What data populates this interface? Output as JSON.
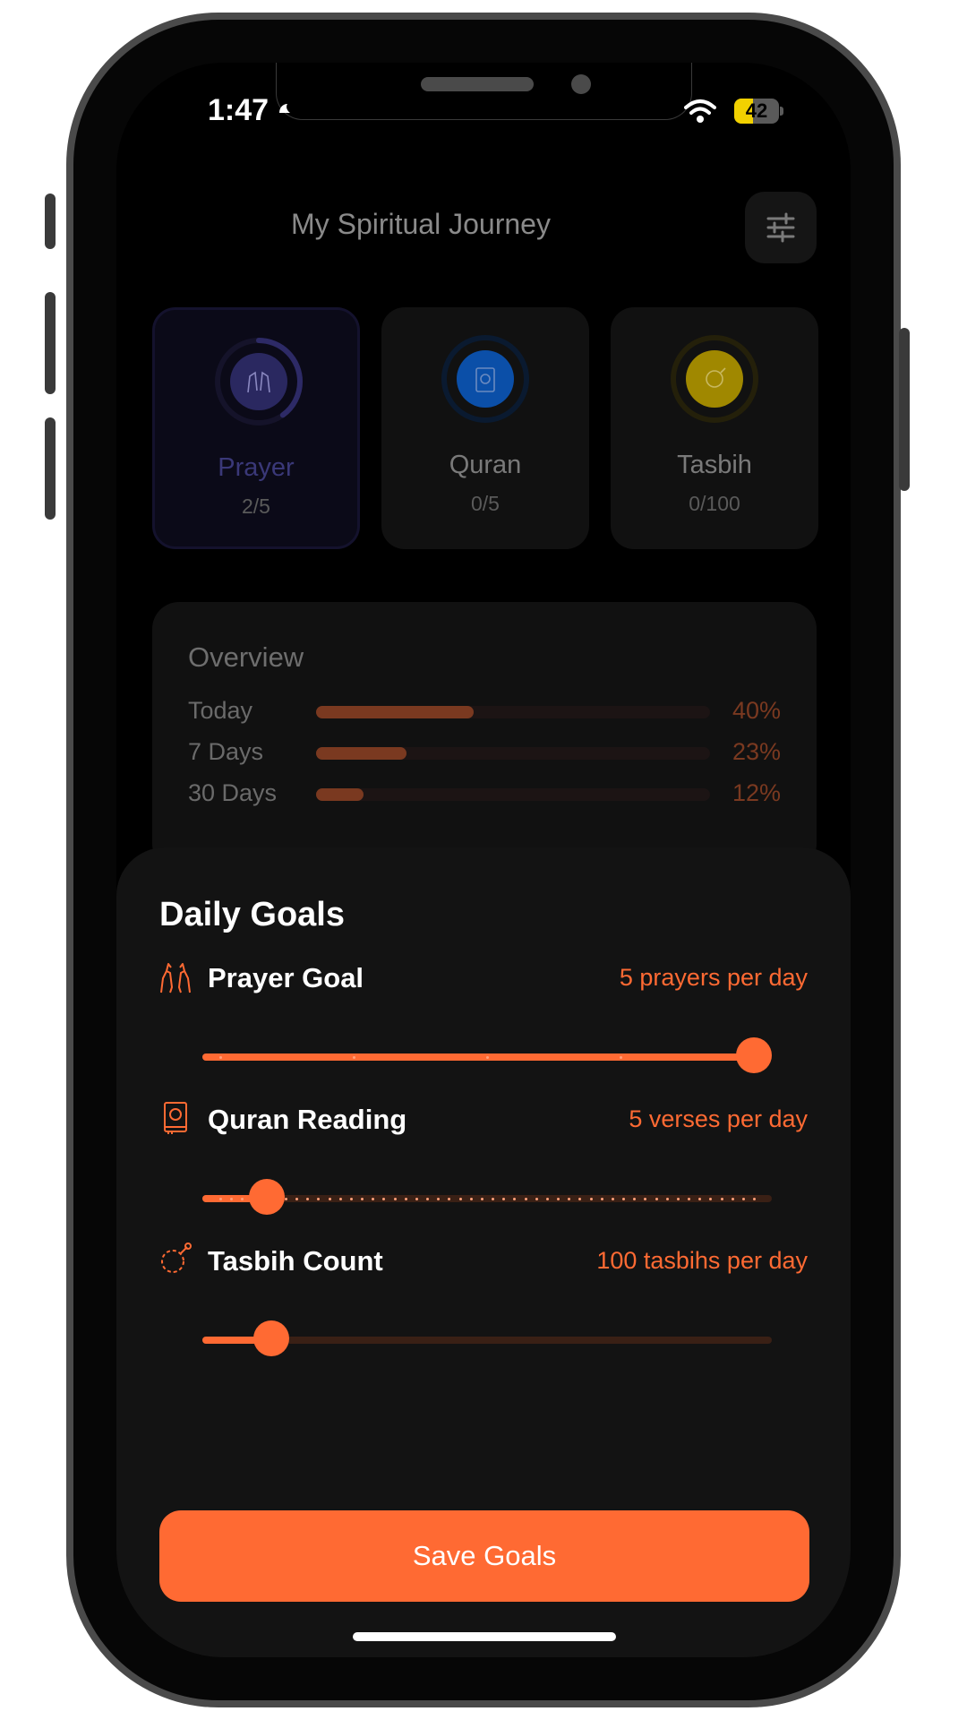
{
  "status_bar": {
    "time": "1:47",
    "battery": "42",
    "battery_level": 0.42
  },
  "header": {
    "title": "My Spiritual Journey",
    "settings_icon": "sliders-icon"
  },
  "cards": [
    {
      "title": "Prayer",
      "count": "2/5",
      "progress": 0.4,
      "icon": "praying-hands-icon",
      "color": "#3a3878",
      "active": true
    },
    {
      "title": "Quran",
      "count": "0/5",
      "progress": 0,
      "icon": "quran-book-icon",
      "color": "#0b4fa8",
      "active": false
    },
    {
      "title": "Tasbih",
      "count": "0/100",
      "progress": 0,
      "icon": "tasbih-beads-icon",
      "color": "#a08800",
      "active": false
    }
  ],
  "overview": {
    "title": "Overview",
    "rows": [
      {
        "label": "Today",
        "percent": "40%",
        "value": 40
      },
      {
        "label": "7 Days",
        "percent": "23%",
        "value": 23
      },
      {
        "label": "30 Days",
        "percent": "12%",
        "value": 12
      }
    ]
  },
  "daily_goals": {
    "title": "Daily Goals",
    "goals": [
      {
        "label": "Prayer Goal",
        "value_text": "5 prayers per day",
        "icon": "praying-hands-icon",
        "fraction": 1.0,
        "ticks": 5
      },
      {
        "label": "Quran Reading",
        "value_text": "5 verses per day",
        "icon": "quran-book-icon",
        "fraction": 0.087,
        "ticks": 50
      },
      {
        "label": "Tasbih Count",
        "value_text": "100 tasbihs per day",
        "icon": "tasbih-beads-icon",
        "fraction": 0.096,
        "ticks": 0
      }
    ],
    "save_label": "Save Goals"
  },
  "colors": {
    "accent": "#ff6a33",
    "background": "#000000",
    "sheet": "#131313"
  }
}
